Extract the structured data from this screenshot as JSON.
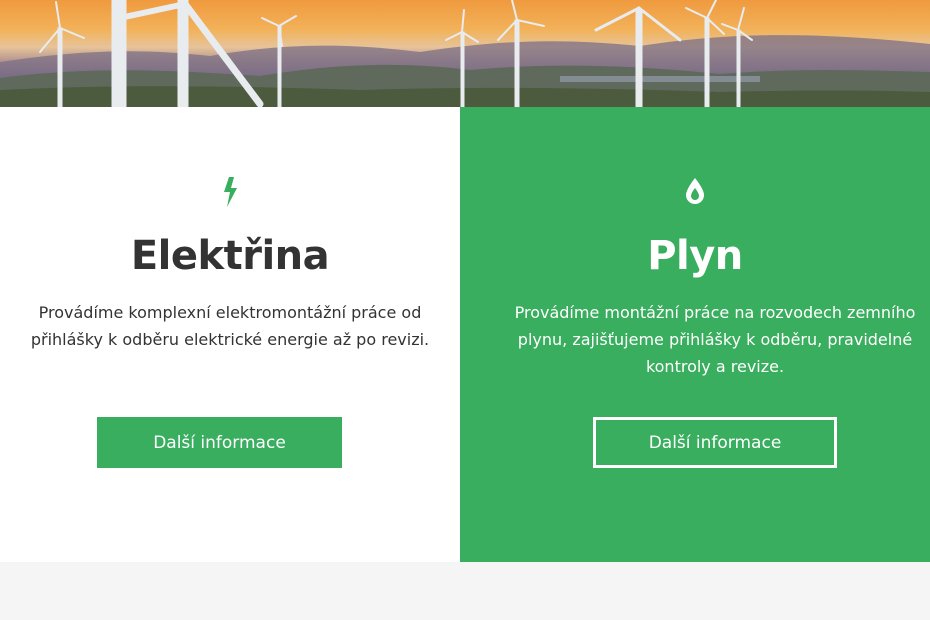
{
  "banner": {
    "alt_subject": "wind-turbines"
  },
  "cards": [
    {
      "icon": "lightning-bolt-icon",
      "title": "Elektřina",
      "text": "Provádíme komplexní elektromontážní práce od přihlášky k odběru elektrické energie až po revizi.",
      "button_label": "Další informace"
    },
    {
      "icon": "water-drop-icon",
      "title": "Plyn",
      "text": "Provádíme montážní práce na rozvodech zemního plynu, zajišťujeme přihlášky k odběru, pravidelné kontroly a revize.",
      "button_label": "Další informace"
    }
  ],
  "colors": {
    "accent": "#39ae5e",
    "heading_dark": "#333333",
    "footer_background": "#f5f5f5"
  }
}
